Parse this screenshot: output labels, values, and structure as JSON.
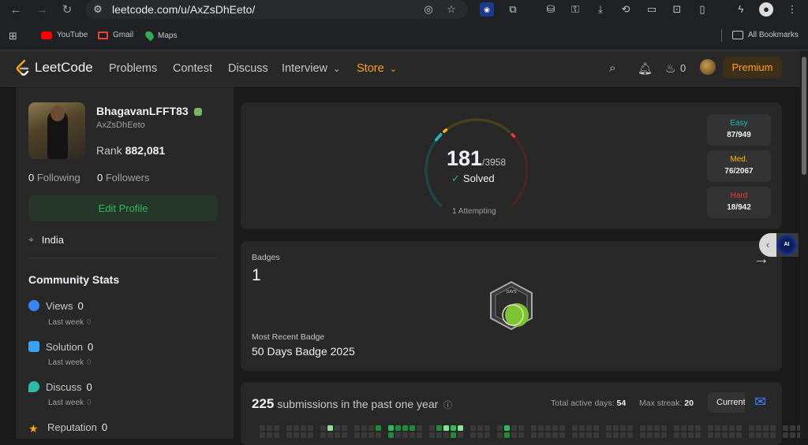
{
  "browser": {
    "url": "leetcode.com/u/AxZsDhEeto/",
    "bookmarks": [
      {
        "label": "YouTube",
        "icon": "youtube-icon",
        "color": "#ff0000"
      },
      {
        "label": "Gmail",
        "icon": "gmail-icon",
        "color": "#ea4335"
      },
      {
        "label": "Maps",
        "icon": "maps-icon",
        "color": "#34a853"
      }
    ],
    "all_bookmarks_label": "All Bookmarks"
  },
  "nav": {
    "logo": "LeetCode",
    "items": [
      "Problems",
      "Contest",
      "Discuss",
      "Interview"
    ],
    "store": "Store",
    "streak_count": "0",
    "premium_label": "Premium"
  },
  "profile": {
    "username": "BhagavanLFFT83",
    "handle": "AxZsDhEeto",
    "rank_label": "Rank",
    "rank_value": "882,081",
    "following_count": "0",
    "following_label": "Following",
    "followers_count": "0",
    "followers_label": "Followers",
    "edit_label": "Edit Profile",
    "location": "India"
  },
  "community": {
    "title": "Community Stats",
    "stats": [
      {
        "label": "Views",
        "value": "0",
        "sub_label": "Last week",
        "sub_value": "0",
        "icon": "eye-icon",
        "color": "#3b82f6"
      },
      {
        "label": "Solution",
        "value": "0",
        "sub_label": "Last week",
        "sub_value": "0",
        "icon": "solution-icon",
        "color": "#38a3f5"
      },
      {
        "label": "Discuss",
        "value": "0",
        "sub_label": "Last week",
        "sub_value": "0",
        "icon": "discuss-icon",
        "color": "#2cbba4"
      },
      {
        "label": "Reputation",
        "value": "0",
        "icon": "star-icon",
        "color": "#ffa116"
      }
    ]
  },
  "progress": {
    "solved": "181",
    "total": "/3958",
    "solved_label": "Solved",
    "attempting": "1 Attempting",
    "easy": {
      "label": "Easy",
      "value": "87/949",
      "color": "#1cbaba",
      "solved": 87,
      "total": 949
    },
    "medium": {
      "label": "Med.",
      "value": "76/2067",
      "color": "#ffb700",
      "solved": 76,
      "total": 2067
    },
    "hard": {
      "label": "Hard",
      "value": "18/942",
      "color": "#f63737",
      "solved": 18,
      "total": 942
    }
  },
  "badges": {
    "label": "Badges",
    "count": "1",
    "recent_label": "Most Recent Badge",
    "recent_name": "50 Days Badge 2025",
    "badge_text": "DAYS"
  },
  "submissions": {
    "count": "225",
    "text": "submissions in the past one year",
    "active_days_label": "Total active days:",
    "active_days": "54",
    "max_streak_label": "Max streak:",
    "max_streak": "20",
    "current_label": "Current"
  },
  "ai_label": "AI"
}
